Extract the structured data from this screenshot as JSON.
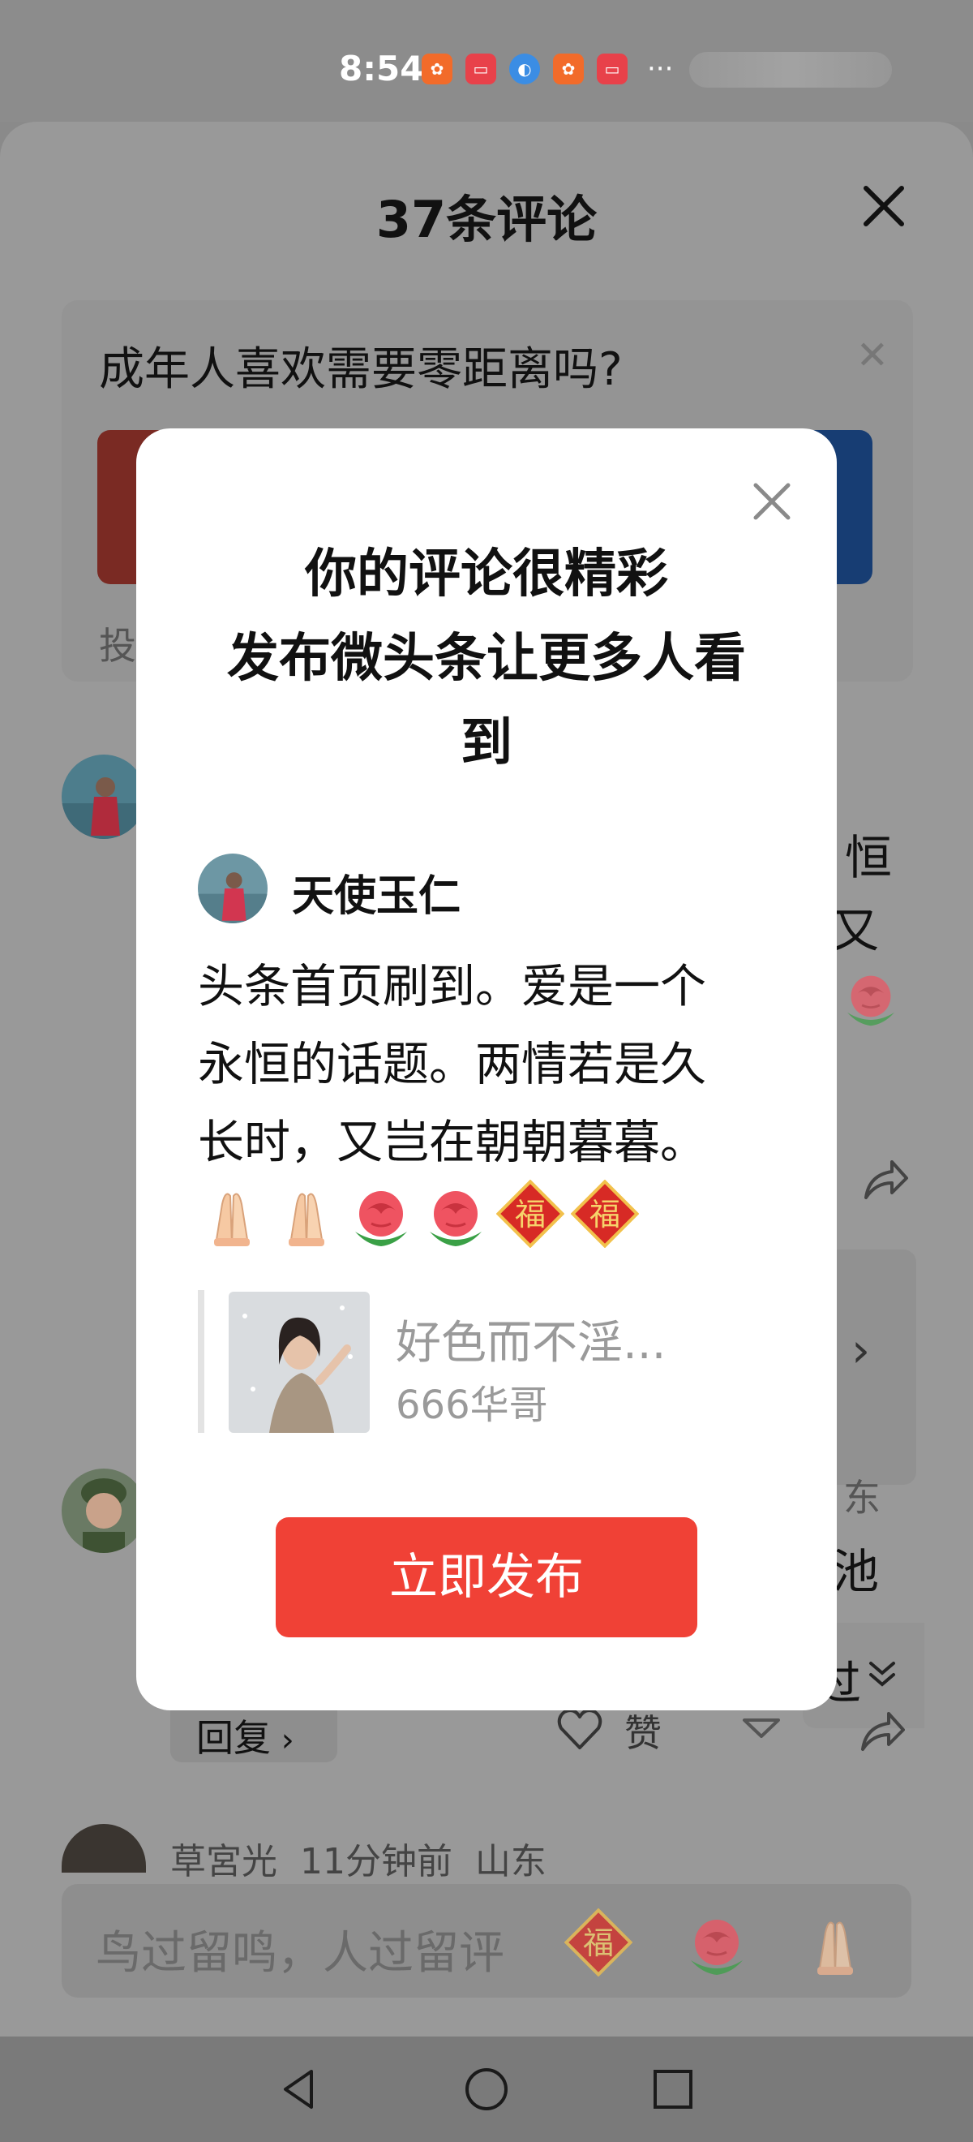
{
  "status_bar": {
    "time": "8:54",
    "app_icons": [
      "app-orange-icon",
      "huawei-store-icon",
      "browser-icon",
      "app-orange-icon",
      "huawei-store-icon"
    ],
    "more": "···"
  },
  "comment_sheet": {
    "title": "37条评论",
    "poll": {
      "question": "成年人喜欢需要零距离吗?",
      "footer_partial": "投"
    },
    "partial_right_text": [
      "恒",
      "又",
      "东",
      "池"
    ],
    "second_comment_meta_partial": "草宮光  11分钟前  山东",
    "reply_label": "回复",
    "like_partial": "赞",
    "collapse_label": "过"
  },
  "input_bar": {
    "placeholder": "鸟过留鸣，人过留评",
    "quick_emojis": [
      "fu-emoji",
      "rose-emoji",
      "pray-emoji"
    ]
  },
  "dialog": {
    "title_lines": [
      "你的评论很精彩",
      "发布微头条让更多人看",
      "到"
    ],
    "author": "天使玉仁",
    "comment_lines": [
      "头条首页刷到。爱是一个",
      "永恒的话题。两情若是久",
      "长时，又岂在朝朝暮暮。"
    ],
    "emojis": [
      "pray-emoji",
      "pray-emoji",
      "rose-emoji",
      "rose-emoji",
      "fu-emoji",
      "fu-emoji"
    ],
    "quote": {
      "title": "好色而不淫...",
      "author": "666华哥"
    },
    "publish_label": "立即发布"
  },
  "colors": {
    "accent_red": "#f04136",
    "overlay_gray": "#999999",
    "dialog_bg": "#ffffff"
  }
}
